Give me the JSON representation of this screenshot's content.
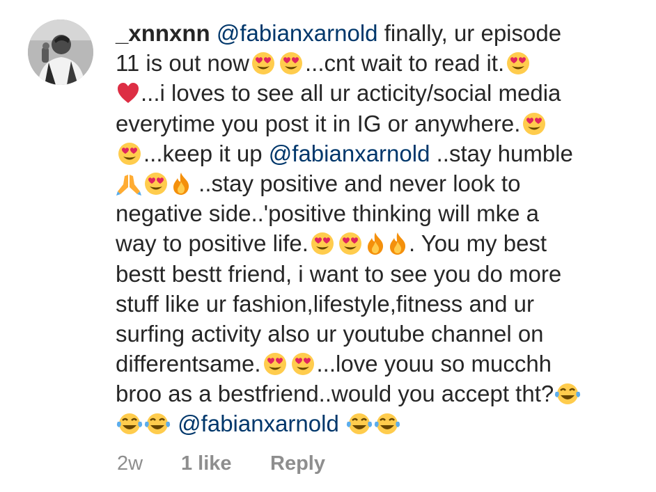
{
  "comment": {
    "username": "_xnnxnn",
    "mention": "@fabianxarnold",
    "avatar_icon": "profile-photo",
    "segments": {
      "l1": " finally, ur episode",
      "l2": "11 is out now",
      "l2b": "...cnt wait to read it.",
      "l3": "...i loves to see all ur acticity/social media",
      "l4": "everytime you post it in IG or anywhere.",
      "l5a": "...keep it up ",
      "l5b": " ..stay humble",
      "l6": " ..stay positive and never look to",
      "l7": "negative side..'positive thinking will mke a",
      "l8a": "way to positive life.",
      "l8b": ". You my best",
      "l9": "bestt bestt friend, i want to see you do more",
      "l10": "stuff like ur fashion,lifestyle,fitness and ur",
      "l11": "surfing activity also ur youtube channel on",
      "l12a": "differentsame.",
      "l12b": "...love youu so mucchh",
      "l13": "broo as a bestfriend..would you accept tht?",
      "l14a": " ",
      "l14b": " "
    },
    "emoji_names": [
      "heart-eyes-emoji",
      "red-heart-emoji",
      "folded-hands-emoji",
      "fire-emoji",
      "tears-of-joy-emoji"
    ],
    "colors": {
      "text": "#262626",
      "mention": "#00376b",
      "meta": "#8e8e8e"
    }
  },
  "meta": {
    "time": "2w",
    "likes": "1 like",
    "reply": "Reply"
  }
}
